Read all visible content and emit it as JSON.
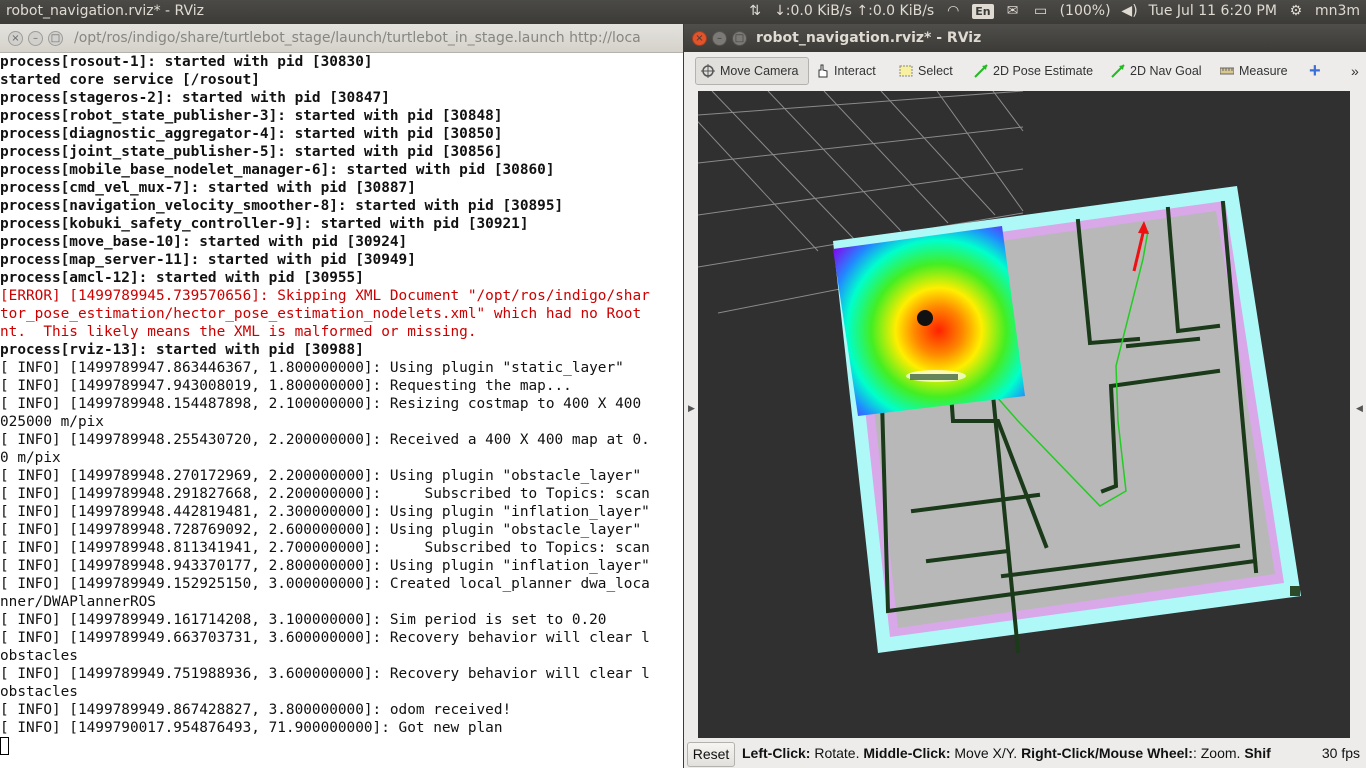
{
  "topbar": {
    "title": "robot_navigation.rviz* - RViz",
    "network": "↓:0.0 KiB/s ↑:0.0 KiB/s",
    "language": "En",
    "battery": "(100%)",
    "datetime": "Tue Jul 11  6:20 PM",
    "user": "mn3m"
  },
  "terminal": {
    "title": "/opt/ros/indigo/share/turtlebot_stage/launch/turtlebot_in_stage.launch http://loca",
    "lines": [
      {
        "t": "process[rosout-1]: started with pid [30830]",
        "k": "b"
      },
      {
        "t": "started core service [/rosout]",
        "k": "b"
      },
      {
        "t": "process[stageros-2]: started with pid [30847]",
        "k": "b"
      },
      {
        "t": "process[robot_state_publisher-3]: started with pid [30848]",
        "k": "b"
      },
      {
        "t": "process[diagnostic_aggregator-4]: started with pid [30850]",
        "k": "b"
      },
      {
        "t": "process[joint_state_publisher-5]: started with pid [30856]",
        "k": "b"
      },
      {
        "t": "process[mobile_base_nodelet_manager-6]: started with pid [30860]",
        "k": "b"
      },
      {
        "t": "process[cmd_vel_mux-7]: started with pid [30887]",
        "k": "b"
      },
      {
        "t": "process[navigation_velocity_smoother-8]: started with pid [30895]",
        "k": "b"
      },
      {
        "t": "process[kobuki_safety_controller-9]: started with pid [30921]",
        "k": "b"
      },
      {
        "t": "process[move_base-10]: started with pid [30924]",
        "k": "b"
      },
      {
        "t": "process[map_server-11]: started with pid [30949]",
        "k": "b"
      },
      {
        "t": "process[amcl-12]: started with pid [30955]",
        "k": "b"
      },
      {
        "t": "[ERROR] [1499789945.739570656]: Skipping XML Document \"/opt/ros/indigo/shar",
        "k": "e"
      },
      {
        "t": "tor_pose_estimation/hector_pose_estimation_nodelets.xml\" which had no Root",
        "k": "e"
      },
      {
        "t": "nt.  This likely means the XML is malformed or missing.",
        "k": "e"
      },
      {
        "t": "process[rviz-13]: started with pid [30988]",
        "k": "b"
      },
      {
        "t": "[ INFO] [1499789947.863446367, 1.800000000]: Using plugin \"static_layer\"",
        "k": "n"
      },
      {
        "t": "[ INFO] [1499789947.943008019, 1.800000000]: Requesting the map...",
        "k": "n"
      },
      {
        "t": "[ INFO] [1499789948.154487898, 2.100000000]: Resizing costmap to 400 X 400",
        "k": "n"
      },
      {
        "t": "025000 m/pix",
        "k": "n"
      },
      {
        "t": "[ INFO] [1499789948.255430720, 2.200000000]: Received a 400 X 400 map at 0.",
        "k": "n"
      },
      {
        "t": "0 m/pix",
        "k": "n"
      },
      {
        "t": "[ INFO] [1499789948.270172969, 2.200000000]: Using plugin \"obstacle_layer\"",
        "k": "n"
      },
      {
        "t": "[ INFO] [1499789948.291827668, 2.200000000]:     Subscribed to Topics: scan",
        "k": "n"
      },
      {
        "t": "[ INFO] [1499789948.442819481, 2.300000000]: Using plugin \"inflation_layer\"",
        "k": "n"
      },
      {
        "t": "[ INFO] [1499789948.728769092, 2.600000000]: Using plugin \"obstacle_layer\"",
        "k": "n"
      },
      {
        "t": "[ INFO] [1499789948.811341941, 2.700000000]:     Subscribed to Topics: scan",
        "k": "n"
      },
      {
        "t": "[ INFO] [1499789948.943370177, 2.800000000]: Using plugin \"inflation_layer\"",
        "k": "n"
      },
      {
        "t": "[ INFO] [1499789949.152925150, 3.000000000]: Created local_planner dwa_loca",
        "k": "n"
      },
      {
        "t": "nner/DWAPlannerROS",
        "k": "n"
      },
      {
        "t": "[ INFO] [1499789949.161714208, 3.100000000]: Sim period is set to 0.20",
        "k": "n"
      },
      {
        "t": "[ INFO] [1499789949.663703731, 3.600000000]: Recovery behavior will clear l",
        "k": "n"
      },
      {
        "t": "obstacles",
        "k": "n"
      },
      {
        "t": "[ INFO] [1499789949.751988936, 3.600000000]: Recovery behavior will clear l",
        "k": "n"
      },
      {
        "t": "obstacles",
        "k": "n"
      },
      {
        "t": "[ INFO] [1499789949.867428827, 3.800000000]: odom received!",
        "k": "n"
      },
      {
        "t": "[ INFO] [1499790017.954876493, 71.900000000]: Got new plan",
        "k": "n"
      }
    ]
  },
  "rviz": {
    "title": "robot_navigation.rviz* - RViz",
    "toolbar": {
      "move_camera": "Move Camera",
      "interact": "Interact",
      "select": "Select",
      "pose_estimate": "2D Pose Estimate",
      "nav_goal": "2D Nav Goal",
      "measure": "Measure",
      "plus": "+",
      "more": "»"
    },
    "status": {
      "reset": "Reset",
      "help_b1": "Left-Click:",
      "help_t1": " Rotate. ",
      "help_b2": "Middle-Click:",
      "help_t2": " Move X/Y. ",
      "help_b3": "Right-Click/Mouse Wheel:",
      "help_t3": ": Zoom. ",
      "help_b4": "Shif",
      "fps": "30 fps"
    }
  },
  "colors": {
    "error": "#cc0000",
    "plan": "#22cc22",
    "goal_arrow": "#ee1111",
    "inflation": "#c8a8e8",
    "cyan": "#aef8f8",
    "wall": "#1a3a1a"
  }
}
